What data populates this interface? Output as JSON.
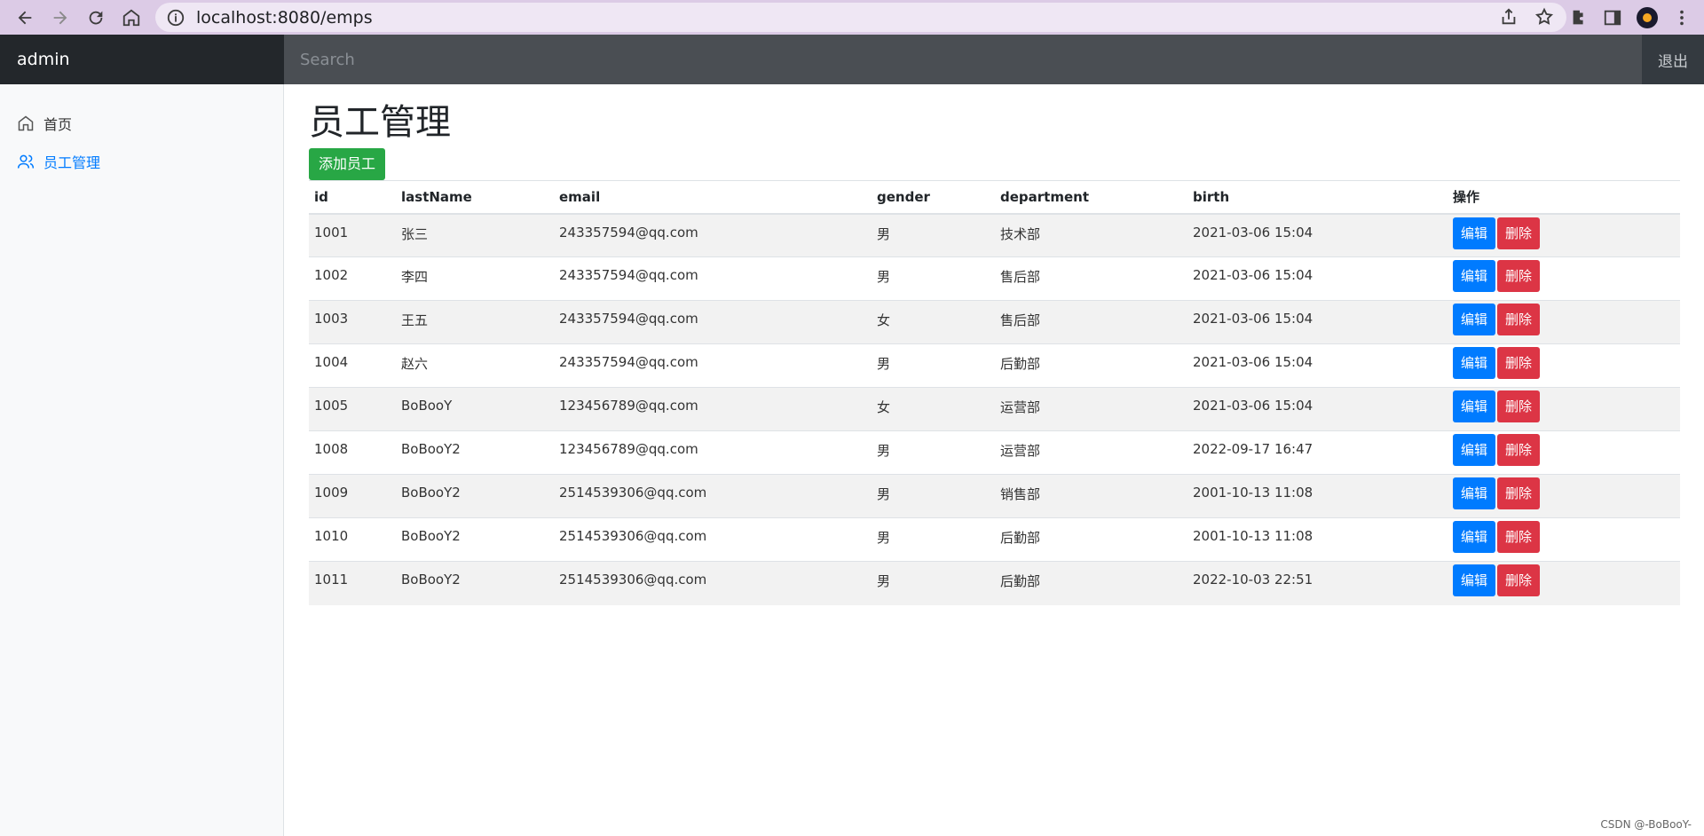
{
  "browser": {
    "url": "localhost:8080/emps"
  },
  "navbar": {
    "brand": "admin",
    "search_placeholder": "Search",
    "signout_label": "退出"
  },
  "sidebar": {
    "items": [
      {
        "label": "首页",
        "icon": "home-icon"
      },
      {
        "label": "员工管理",
        "icon": "users-icon",
        "active": true
      }
    ]
  },
  "main": {
    "title": "员工管理",
    "add_button": "添加员工",
    "columns": [
      "id",
      "lastName",
      "email",
      "gender",
      "department",
      "birth",
      "操作"
    ],
    "edit_label": "编辑",
    "delete_label": "删除",
    "rows": [
      [
        "1001",
        "张三",
        "243357594@qq.com",
        "男",
        "技术部",
        "2021-03-06 15:04"
      ],
      [
        "1002",
        "李四",
        "243357594@qq.com",
        "男",
        "售后部",
        "2021-03-06 15:04"
      ],
      [
        "1003",
        "王五",
        "243357594@qq.com",
        "女",
        "售后部",
        "2021-03-06 15:04"
      ],
      [
        "1004",
        "赵六",
        "243357594@qq.com",
        "男",
        "后勤部",
        "2021-03-06 15:04"
      ],
      [
        "1005",
        "BoBooY",
        "123456789@qq.com",
        "女",
        "运营部",
        "2021-03-06 15:04"
      ],
      [
        "1008",
        "BoBooY2",
        "123456789@qq.com",
        "男",
        "运营部",
        "2022-09-17 16:47"
      ],
      [
        "1009",
        "BoBooY2",
        "2514539306@qq.com",
        "男",
        "销售部",
        "2001-10-13 11:08"
      ],
      [
        "1010",
        "BoBooY2",
        "2514539306@qq.com",
        "男",
        "后勤部",
        "2001-10-13 11:08"
      ],
      [
        "1011",
        "BoBooY2",
        "2514539306@qq.com",
        "男",
        "后勤部",
        "2022-10-03 22:51"
      ]
    ]
  },
  "watermark": "CSDN @-BoBooY-",
  "colors": {
    "primary": "#007bff",
    "danger": "#dc3545",
    "success": "#28a745",
    "navbar": "#343a40"
  }
}
